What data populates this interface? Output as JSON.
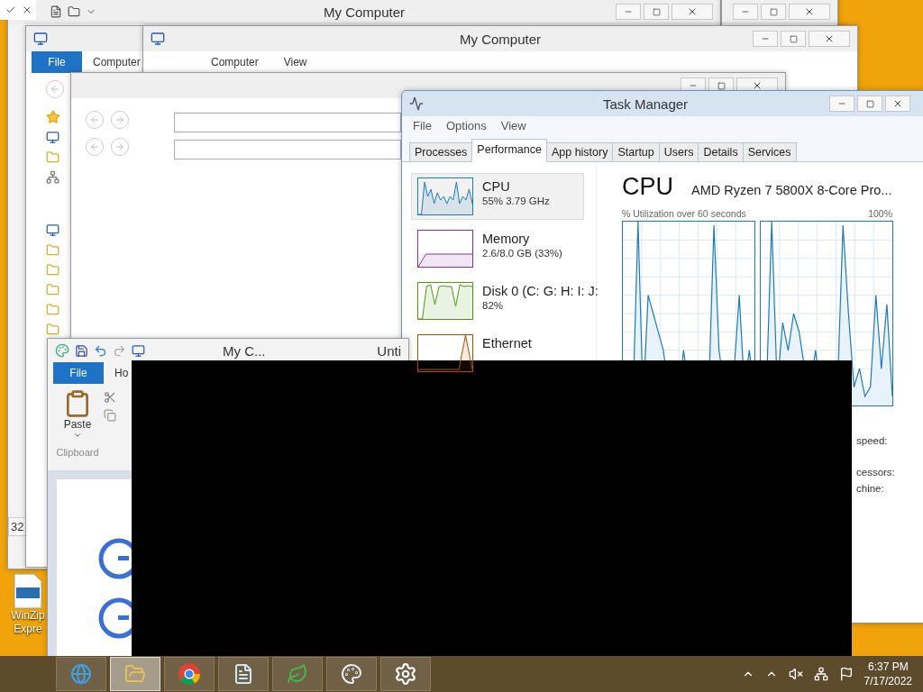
{
  "explorer_back": {
    "title": "My Computer",
    "status_number": "32"
  },
  "explorer_left": {
    "ribbon_tabs": [
      "File",
      "Computer"
    ]
  },
  "explorer_front": {
    "title": "My Computer",
    "ribbon_tabs": [
      "Computer",
      "View"
    ]
  },
  "paint": {
    "title": "My C...",
    "title_2": "Unti",
    "ribbon_tabs": [
      "File",
      "Ho"
    ],
    "paste_label": "Paste",
    "group_label": "Clipboard"
  },
  "task_manager": {
    "title": "Task Manager",
    "menu": [
      "File",
      "Options",
      "View"
    ],
    "tabs": [
      {
        "label": "Processes",
        "selected": false
      },
      {
        "label": "Performance",
        "selected": true
      },
      {
        "label": "App history",
        "selected": false
      },
      {
        "label": "Startup",
        "selected": false
      },
      {
        "label": "Users",
        "selected": false
      },
      {
        "label": "Details",
        "selected": false
      },
      {
        "label": "Services",
        "selected": false
      }
    ],
    "resources": [
      {
        "kind": "cpu",
        "name": "CPU",
        "detail": "55%  3.79 GHz",
        "selected": true,
        "color": "#1f7ab8"
      },
      {
        "kind": "memory",
        "name": "Memory",
        "detail": "2.6/8.0 GB (33%)",
        "selected": false,
        "color": "#8b2fa8"
      },
      {
        "kind": "disk",
        "name": "Disk 0 (C: G: H: I: J:",
        "detail": "82%",
        "selected": false,
        "color": "#4d9a0e"
      },
      {
        "kind": "ethernet",
        "name": "Ethernet",
        "selected": false,
        "color": "#a74f01"
      }
    ],
    "heading": "CPU",
    "model": "AMD Ryzen 7 5800X 8-Core Pro...",
    "graph_caption": "% Utilization over 60 seconds",
    "graph_max": "100%",
    "stats": [
      "speed:",
      "cessors:",
      "chine:"
    ]
  },
  "desktop_icons": [
    {
      "label_lines": [
        "WinZip",
        "Expre"
      ]
    }
  ],
  "taskbar": {
    "apps": [
      {
        "kind": "browser",
        "selected": false
      },
      {
        "kind": "explorer",
        "selected": true
      },
      {
        "kind": "chrome",
        "selected": false
      },
      {
        "kind": "notepad",
        "selected": false
      },
      {
        "kind": "plant",
        "selected": false
      },
      {
        "kind": "paint",
        "selected": false
      },
      {
        "kind": "settings",
        "selected": false
      }
    ],
    "time": "6:37 PM",
    "date": "7/17/2022"
  }
}
